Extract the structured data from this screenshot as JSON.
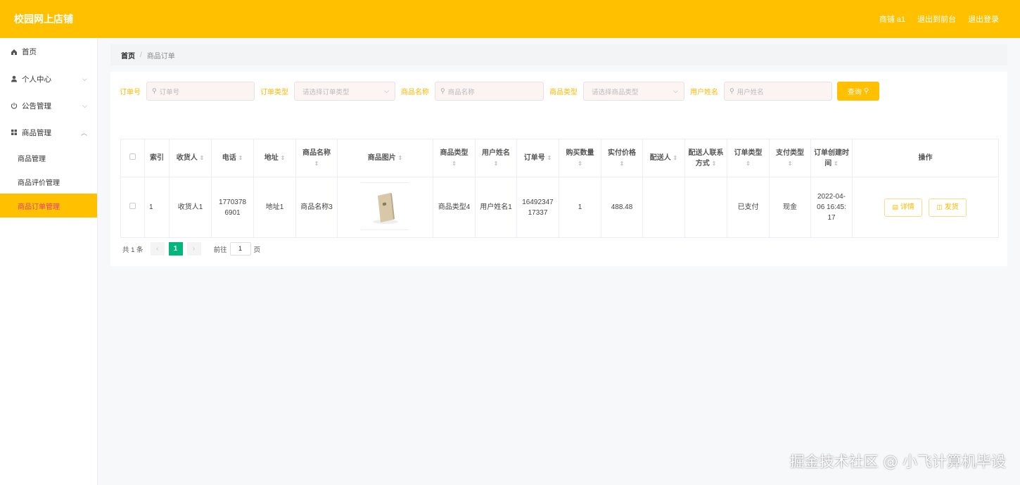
{
  "header": {
    "title": "校园网上店铺",
    "user": "商铺 a1",
    "back_to_front": "退出到前台",
    "logout": "退出登录"
  },
  "sidebar": {
    "items": [
      {
        "label": "首页",
        "icon": "home-icon"
      },
      {
        "label": "个人中心",
        "icon": "user-icon"
      },
      {
        "label": "公告管理",
        "icon": "power-icon"
      },
      {
        "label": "商品管理",
        "icon": "grid-icon"
      }
    ],
    "sub_items": [
      {
        "label": "商品管理"
      },
      {
        "label": "商品评价管理"
      },
      {
        "label": "商品订单管理"
      }
    ]
  },
  "breadcrumb": {
    "home": "首页",
    "sep": "/",
    "current": "商品订单"
  },
  "search": {
    "order_no_label": "订单号",
    "order_no_placeholder": "订单号",
    "order_type_label": "订单类型",
    "order_type_placeholder": "请选择订单类型",
    "product_name_label": "商品名称",
    "product_name_placeholder": "商品名称",
    "product_type_label": "商品类型",
    "product_type_placeholder": "请选择商品类型",
    "user_name_label": "用户姓名",
    "user_name_placeholder": "用户姓名",
    "query_button": "查询"
  },
  "table": {
    "headers": [
      "索引",
      "收货人",
      "电话",
      "地址",
      "商品名称",
      "商品图片",
      "商品类型",
      "用户姓名",
      "订单号",
      "购买数量",
      "实付价格",
      "配送人",
      "配送人联系方式",
      "订单类型",
      "支付类型",
      "订单创建时间",
      "操作"
    ],
    "rows": [
      {
        "index": "1",
        "receiver": "收货人1",
        "phone": "17703786901",
        "address": "地址1",
        "product_name": "商品名称3",
        "product_type": "商品类型4",
        "user_name": "用户姓名1",
        "order_no": "1649234717337",
        "quantity": "1",
        "paid_price": "488.48",
        "courier": "",
        "courier_contact": "",
        "order_type": "已支付",
        "pay_type": "现金",
        "created": "2022-04-06 16:45:17",
        "detail_button": "详情",
        "ship_button": "发货"
      }
    ]
  },
  "pagination": {
    "total": "共 1 条",
    "current_page": "1",
    "goto_label": "前往",
    "goto_value": "1",
    "page_suffix": "页"
  },
  "watermark": "掘金技术社区 @ 小飞计算机毕设",
  "colors": {
    "accent": "#ffc000",
    "active_page": "#00b67a",
    "active_sub_text": "#e0407a"
  }
}
